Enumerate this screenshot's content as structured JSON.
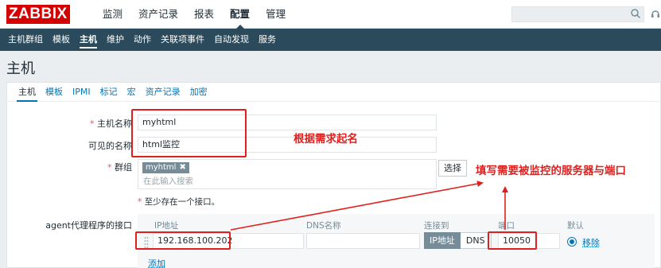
{
  "logo": "ZABBIX",
  "top_menu": [
    "监测",
    "资产记录",
    "报表",
    "配置",
    "管理"
  ],
  "sub_menu": [
    "主机群组",
    "模板",
    "主机",
    "维护",
    "动作",
    "关联项事件",
    "自动发现",
    "服务"
  ],
  "page_title": "主机",
  "tabs": [
    "主机",
    "模板",
    "IPMI",
    "标记",
    "宏",
    "资产记录",
    "加密"
  ],
  "form": {
    "host_name_label": "主机名称",
    "host_name_value": "myhtml",
    "visible_name_label": "可见的名称",
    "visible_name_value": "html监控",
    "groups_label": "群组",
    "group_chip": "myhtml",
    "group_placeholder": "在此输入搜索",
    "select_button": "选择",
    "hint": "至少存在一个接口。",
    "required_mark": "*",
    "interfaces_label": "agent代理程序的接口"
  },
  "interface": {
    "col_ip": "IP地址",
    "col_dns": "DNS名称",
    "col_connect": "连接到",
    "col_port": "端口",
    "col_default": "默认",
    "ip_value": "192.168.100.202",
    "dns_value": "",
    "connect_ip": "IP地址",
    "connect_dns": "DNS",
    "port_value": "10050",
    "remove_link": "移除",
    "add_link": "添加"
  },
  "annotations": {
    "name_note": "根据需求起名",
    "server_note": "填写需要被监控的服务器与端口"
  },
  "icons": [
    "search-icon",
    "help-icon",
    "drag-handle-icon",
    "remove-chip-icon"
  ],
  "colors": {
    "brand": "#d40000",
    "subnav": "#2b4b5c",
    "link": "#0275b8",
    "annotation": "#e0201f"
  }
}
